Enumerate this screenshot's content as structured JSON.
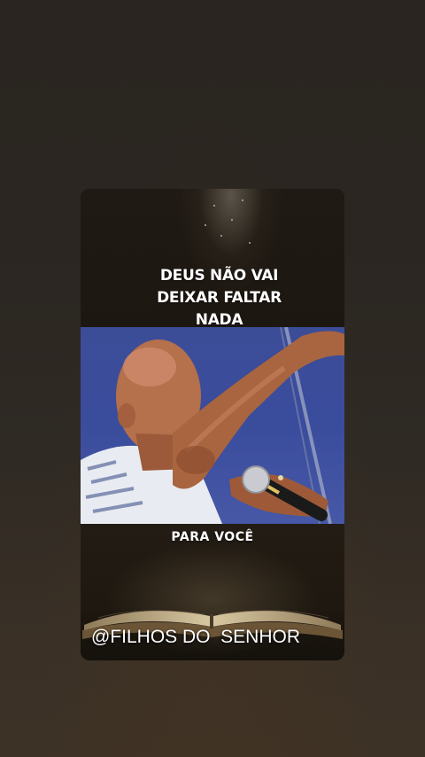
{
  "post": {
    "headline_lines": [
      "DEUS NÃO VAI",
      "DEIXAR FALTAR",
      "NADA"
    ],
    "subline": "PARA VOCÊ",
    "handle": "@FILHOS DO  SENHOR"
  },
  "colors": {
    "background": "#2b2621",
    "card": "#17120c",
    "text": "#ffffff",
    "photo_sky": "#3a4c9c"
  },
  "icons": {
    "microphone": "microphone-icon",
    "bible": "open-book-icon"
  }
}
